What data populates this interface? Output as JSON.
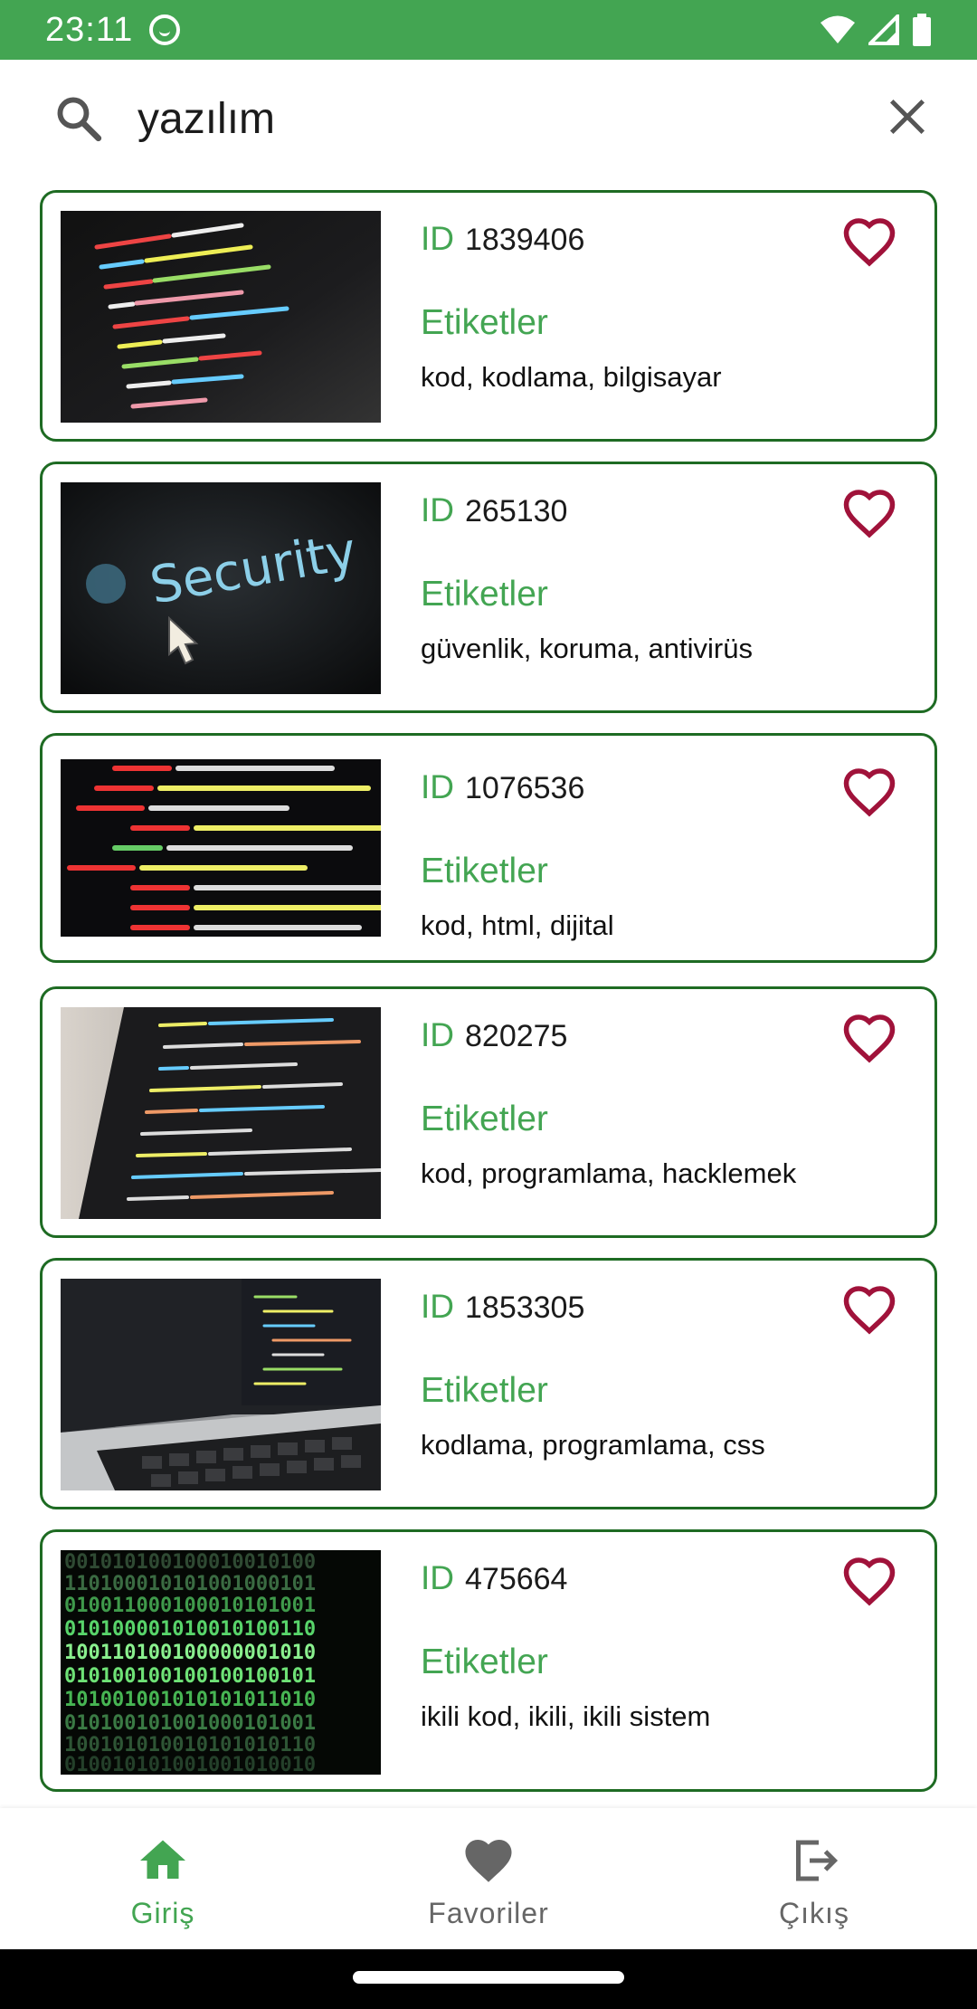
{
  "status_bar": {
    "time": "23:11"
  },
  "search": {
    "value": "yazılım"
  },
  "results": [
    {
      "id_label": "ID",
      "id": "1839406",
      "tags_title": "Etiketler",
      "tags": "kod, kodlama, bilgisayar",
      "favorite": false,
      "image": "code-screen"
    },
    {
      "id_label": "ID",
      "id": "265130",
      "tags_title": "Etiketler",
      "tags": "güvenlik, koruma, antivirüs",
      "favorite": false,
      "image": "security-screen",
      "image_text": "Security"
    },
    {
      "id_label": "ID",
      "id": "1076536",
      "tags_title": "Etiketler",
      "tags": "kod, html, dijital",
      "favorite": false,
      "image": "html-code"
    },
    {
      "id_label": "ID",
      "id": "820275",
      "tags_title": "Etiketler",
      "tags": "kod, programlama, hacklemek",
      "favorite": false,
      "image": "laptop-code"
    },
    {
      "id_label": "ID",
      "id": "1853305",
      "tags_title": "Etiketler",
      "tags": "kodlama, programlama, css",
      "favorite": false,
      "image": "macbook"
    },
    {
      "id_label": "ID",
      "id": "475664",
      "tags_title": "Etiketler",
      "tags": "ikili kod, ikili, ikili sistem",
      "favorite": false,
      "image": "binary-code"
    }
  ],
  "bottom_nav": [
    {
      "label": "Giriş",
      "icon": "home-icon",
      "active": true
    },
    {
      "label": "Favoriler",
      "icon": "heart-filled-icon",
      "active": false
    },
    {
      "label": "Çıkış",
      "icon": "logout-icon",
      "active": false
    }
  ],
  "colors": {
    "primary": "#43a552",
    "card_border": "#1e6b23",
    "heart": "#a0123a"
  }
}
